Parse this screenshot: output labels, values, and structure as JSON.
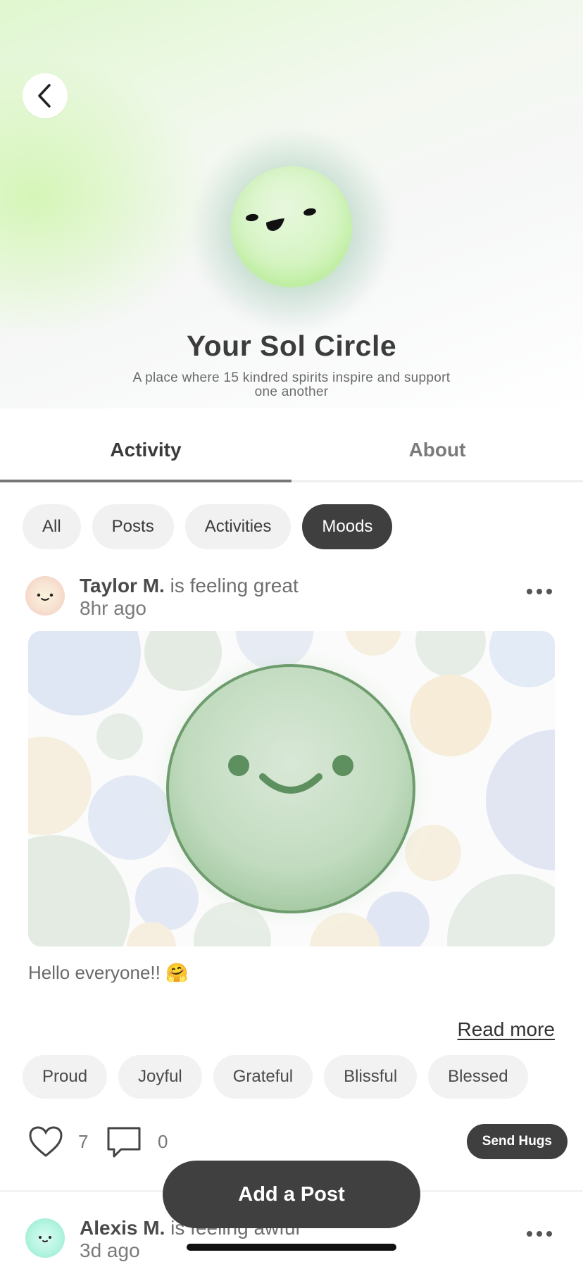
{
  "hero": {
    "title": "Your Sol Circle",
    "subtitle": "A place where 15 kindred spirits inspire and support one another"
  },
  "tabs": [
    {
      "label": "Activity",
      "active": true
    },
    {
      "label": "About",
      "active": false
    }
  ],
  "filters": [
    {
      "label": "All",
      "selected": false
    },
    {
      "label": "Posts",
      "selected": false
    },
    {
      "label": "Activities",
      "selected": false
    },
    {
      "label": "Moods",
      "selected": true
    }
  ],
  "posts": [
    {
      "author": "Taylor M.",
      "feeling": "is feeling great",
      "time": "8hr ago",
      "text": "Hello everyone!! 🤗",
      "read_more": "Read more",
      "moods": [
        "Proud",
        "Joyful",
        "Grateful",
        "Blissful",
        "Blessed"
      ],
      "likes": "7",
      "comments": "0",
      "send_hugs": "Send Hugs"
    },
    {
      "author": "Alexis M.",
      "feeling": "is feeling awful",
      "time": "3d ago"
    }
  ],
  "add_post_label": "Add a Post",
  "colors": {
    "accent_dark": "#404040",
    "mood_green": "#5d8f5f",
    "chip_bg": "#f1f1f1"
  }
}
